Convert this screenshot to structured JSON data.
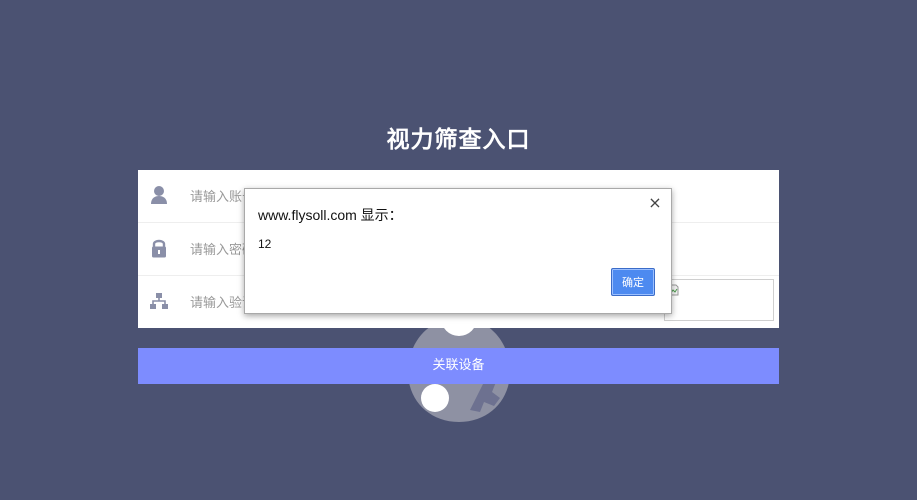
{
  "page": {
    "title": "视力筛查入口",
    "submit_label": "关联设备"
  },
  "form": {
    "account_placeholder": "请输入账号",
    "password_placeholder": "请输入密码",
    "captcha_placeholder": "请输入验证码",
    "icons": [
      "user-icon",
      "lock-icon",
      "sitemap-icon"
    ]
  },
  "dialog": {
    "title": "www.flysoll.com 显示：",
    "message": "12",
    "ok_label": "确定",
    "close_label": "×"
  },
  "colors": {
    "background": "#4b5272",
    "button": "#7d8cff",
    "icon": "#8a8fa8",
    "dialog_button": "#4d8af0"
  }
}
